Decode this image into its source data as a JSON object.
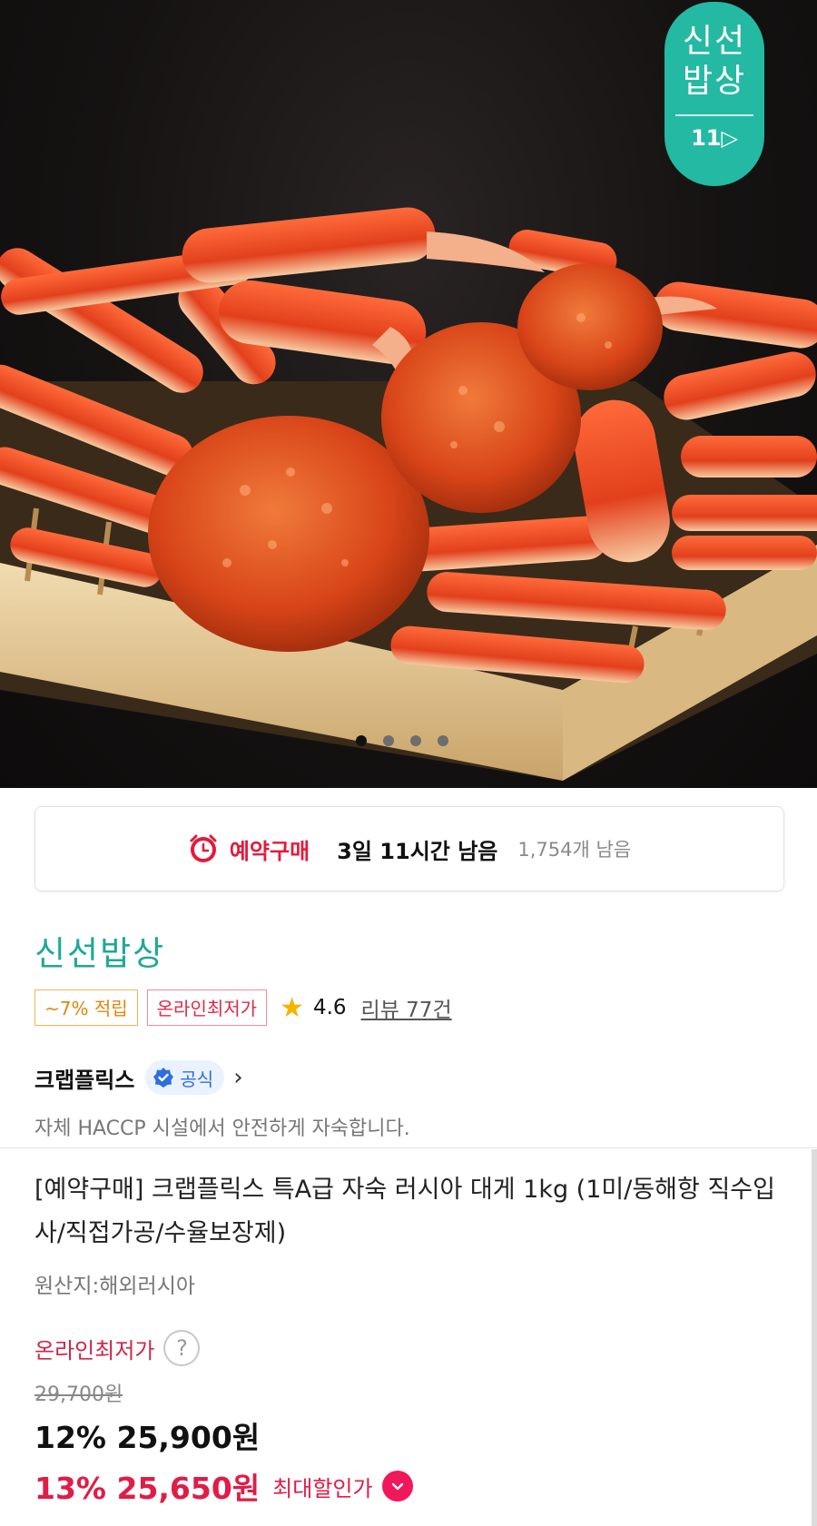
{
  "hero": {
    "badge_line1": "신선",
    "badge_line2": "밥상",
    "badge_mark": "11",
    "badge_color": "#24b9a2",
    "carousel_total": 4,
    "carousel_active": 1
  },
  "reservation": {
    "icon": "alarm-clock-icon",
    "label": "예약구매",
    "time_left": "3일 11시간 남음",
    "stock_left": "1,754개 남음"
  },
  "store": {
    "name": "신선밥상",
    "tag_points": "~7% 적립",
    "tag_lowest": "온라인최저가",
    "rating": "4.6",
    "reviews": "리뷰 77건"
  },
  "seller": {
    "name": "크랩플릭스",
    "official_label": "공식",
    "description": "자체 HACCP 시설에서 안전하게 자숙합니다."
  },
  "product": {
    "title": "[예약구매] 크랩플릭스 특A급 자숙 러시아 대게 1kg (1미/동해항 직수입사/직접가공/수율보장제)",
    "origin": "원산지:해외러시아",
    "lowest_label": "온라인최저가",
    "help_symbol": "?",
    "original_price": "29,700원",
    "price_line1": "12% 25,900원",
    "price_line2": "13% 25,650원",
    "max_discount_label": "최대할인가"
  },
  "colors": {
    "accent_red": "#e01c47",
    "teal": "#1fa896",
    "official_blue": "#2f6de0"
  }
}
